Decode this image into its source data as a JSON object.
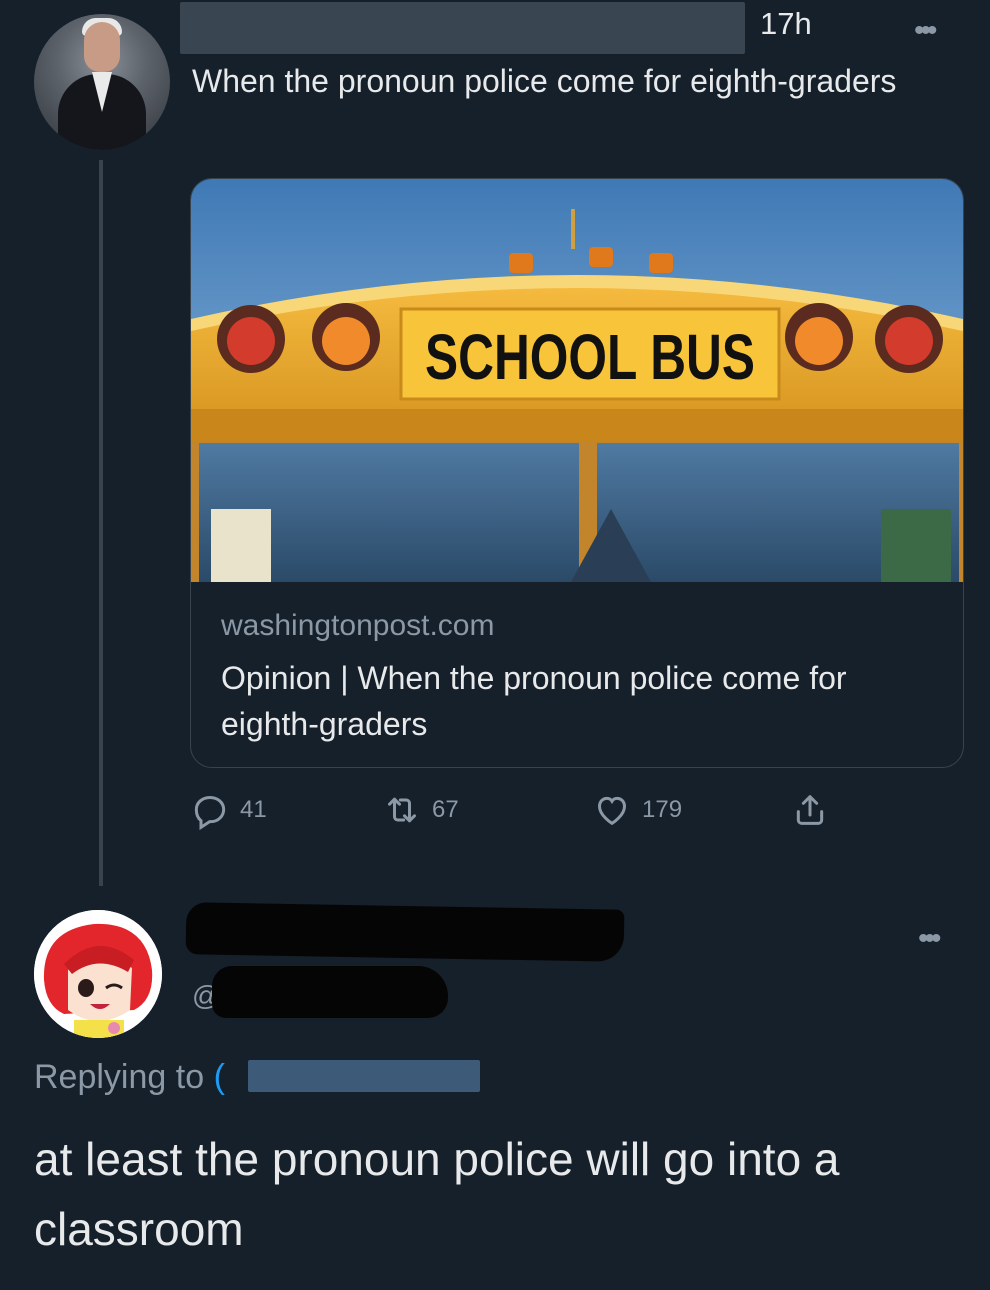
{
  "tweet": {
    "time": "17h",
    "more_label": "•••",
    "text": "When the pronoun police come for eighth-graders",
    "card": {
      "image_caption": "SCHOOL BUS",
      "domain": "washingtonpost.com",
      "title": "Opinion | When the pronoun police come for eighth-graders"
    },
    "actions": {
      "replies": "41",
      "retweets": "67",
      "likes": "179"
    }
  },
  "reply": {
    "handle_prefix": "@",
    "more_label": "•••",
    "replying_label": "Replying to",
    "replying_partial": "(",
    "text": "at least the pronoun police will go into a classroom"
  },
  "colors": {
    "background": "#15202b",
    "text_primary": "#e7e9ea",
    "text_secondary": "#8b98a5",
    "border": "#38444d"
  }
}
